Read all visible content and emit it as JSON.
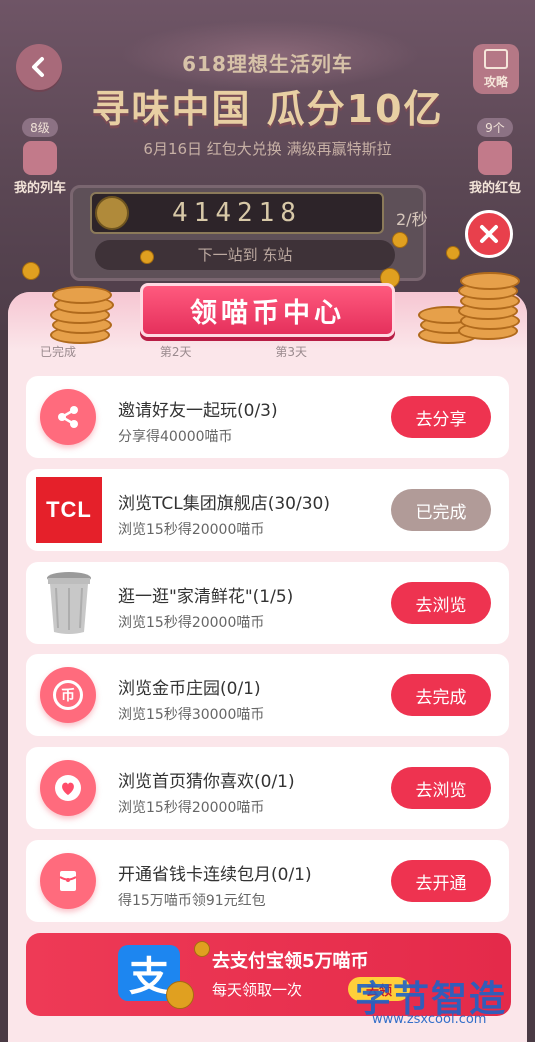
{
  "header": {
    "subtitle": "618理想生活列车",
    "title": "寻味中国 瓜分10亿",
    "date_line": "6月16日 红包大兑换 满级再赢特斯拉",
    "left_badge": "8级",
    "left_label": "我的列车",
    "right_badge": "9个",
    "right_label": "我的红包",
    "strategy_label": "攻略",
    "coin_count": "414218",
    "rate": "2/秒",
    "next_stop": "下一站到 东站"
  },
  "modal": {
    "title": "领喵币中心",
    "peek_items": [
      "已完成",
      "第2天",
      "第3天"
    ]
  },
  "tasks": [
    {
      "title": "邀请好友一起玩(0/3)",
      "desc": "分享得40000喵币",
      "button": "去分享",
      "icon": "share-icon"
    },
    {
      "title": "浏览TCL集团旗舰店(30/30)",
      "desc": "浏览15秒得20000喵币",
      "button": "已完成",
      "icon": "tcl-logo",
      "logo_text": "TCL"
    },
    {
      "title": "逛一逛\"家清鲜花\"(1/5)",
      "desc": "浏览15秒得20000喵币",
      "button": "去浏览",
      "icon": "trash-bin-image"
    },
    {
      "title": "浏览金币庄园(0/1)",
      "desc": "浏览15秒得30000喵币",
      "button": "去完成",
      "icon": "coin-icon",
      "icon_glyph": "币"
    },
    {
      "title": "浏览首页猜你喜欢(0/1)",
      "desc": "浏览15秒得20000喵币",
      "button": "去浏览",
      "icon": "heart-icon"
    },
    {
      "title": "开通省钱卡连续包月(0/1)",
      "desc": "得15万喵币领91元红包",
      "button": "去开通",
      "icon": "red-packet-icon"
    }
  ],
  "alipay": {
    "logo_glyph": "支",
    "title": "去支付宝领5万喵币",
    "subtitle": "每天领取一次",
    "button": "去领"
  },
  "watermark": {
    "title": "字节智造",
    "url": "www.zsxcool.com"
  },
  "colors": {
    "accent": "#ee3350",
    "done": "#b19b98",
    "modal_bg": "#fbe6ea",
    "alipay_blue": "#1d86f0"
  }
}
